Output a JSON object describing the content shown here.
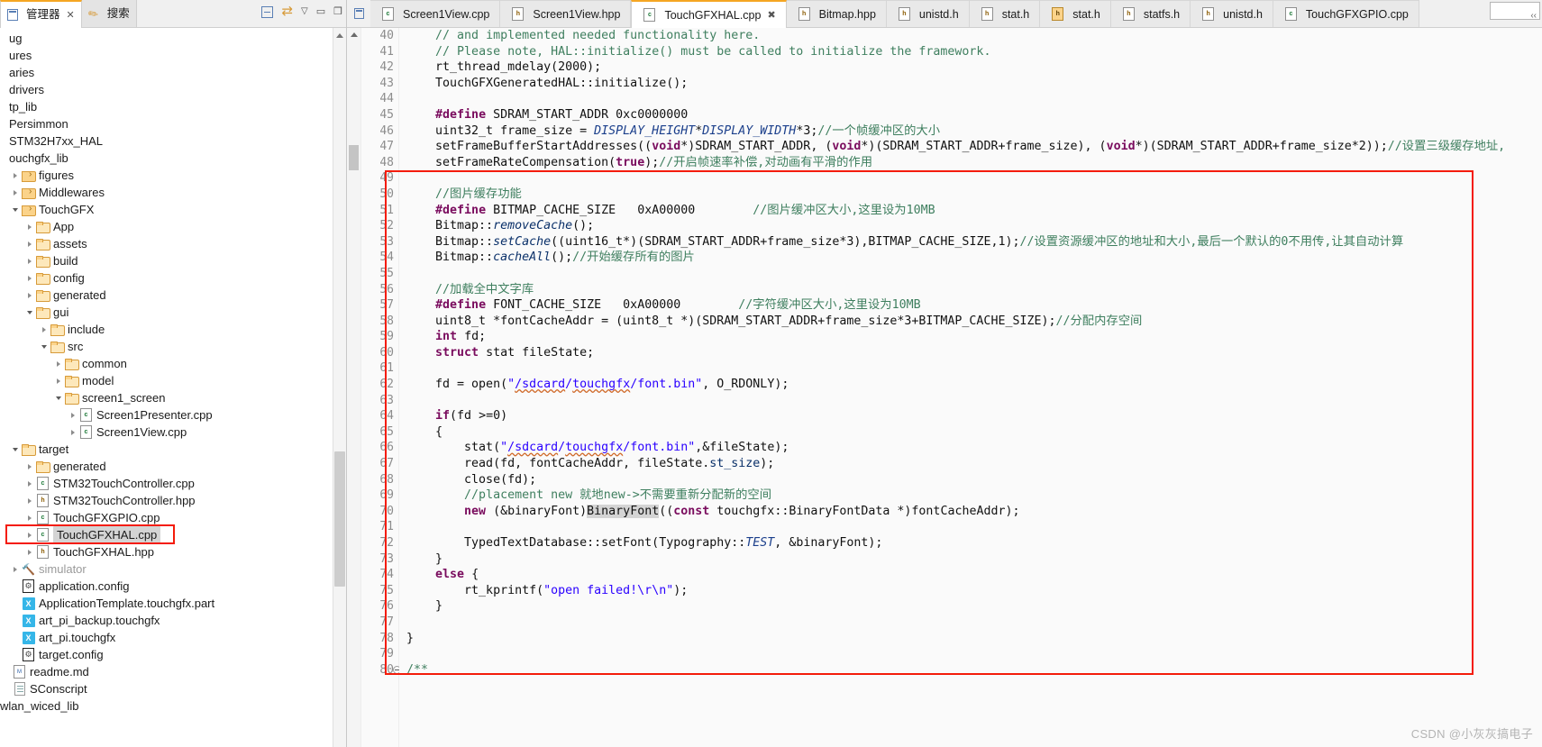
{
  "left_panel": {
    "tabs": [
      {
        "label": "管理器",
        "icon": "project-explorer-icon",
        "active": true,
        "closable": true
      },
      {
        "label": "搜索",
        "icon": "search-icon",
        "active": false,
        "closable": false
      }
    ],
    "toolbar": [
      {
        "name": "collapse-all-icon",
        "glyph": "⊟"
      },
      {
        "name": "link-with-editor-icon",
        "glyph": "⇄"
      },
      {
        "name": "view-menu-icon",
        "glyph": "▽"
      },
      {
        "name": "minimize-icon",
        "glyph": "▭"
      },
      {
        "name": "maximize-icon",
        "glyph": "▯"
      }
    ],
    "tree": [
      {
        "label": "ug",
        "indent": 0,
        "toggle": "none",
        "icon": "none",
        "clipped": true
      },
      {
        "label": "ures",
        "indent": 0,
        "toggle": "none",
        "icon": "none",
        "clipped": true
      },
      {
        "label": "aries",
        "indent": 0,
        "toggle": "none",
        "icon": "none",
        "clipped": true
      },
      {
        "label": "drivers",
        "indent": 0,
        "toggle": "none",
        "icon": "none",
        "clipped": true
      },
      {
        "label": "tp_lib",
        "indent": 0,
        "toggle": "none",
        "icon": "none",
        "clipped": true
      },
      {
        "label": "Persimmon",
        "indent": 0,
        "toggle": "none",
        "icon": "none",
        "clipped": true
      },
      {
        "label": "STM32H7xx_HAL",
        "indent": 0,
        "toggle": "none",
        "icon": "none",
        "clipped": true
      },
      {
        "label": "ouchgfx_lib",
        "indent": 0,
        "toggle": "none",
        "icon": "none",
        "clipped": true
      },
      {
        "label": "figures",
        "indent": 0,
        "toggle": "right",
        "icon": "folder-arrow"
      },
      {
        "label": "Middlewares",
        "indent": 0,
        "toggle": "right",
        "icon": "folder-arrow"
      },
      {
        "label": "TouchGFX",
        "indent": 0,
        "toggle": "down",
        "icon": "folder-arrow"
      },
      {
        "label": "App",
        "indent": 1,
        "toggle": "right",
        "icon": "folder"
      },
      {
        "label": "assets",
        "indent": 1,
        "toggle": "right",
        "icon": "folder"
      },
      {
        "label": "build",
        "indent": 1,
        "toggle": "right",
        "icon": "folder"
      },
      {
        "label": "config",
        "indent": 1,
        "toggle": "right",
        "icon": "folder"
      },
      {
        "label": "generated",
        "indent": 1,
        "toggle": "right",
        "icon": "folder"
      },
      {
        "label": "gui",
        "indent": 1,
        "toggle": "down",
        "icon": "folder"
      },
      {
        "label": "include",
        "indent": 2,
        "toggle": "right",
        "icon": "folder"
      },
      {
        "label": "src",
        "indent": 2,
        "toggle": "down",
        "icon": "folder"
      },
      {
        "label": "common",
        "indent": 3,
        "toggle": "right",
        "icon": "folder"
      },
      {
        "label": "model",
        "indent": 3,
        "toggle": "right",
        "icon": "folder"
      },
      {
        "label": "screen1_screen",
        "indent": 3,
        "toggle": "down",
        "icon": "folder"
      },
      {
        "label": "Screen1Presenter.cpp",
        "indent": 4,
        "toggle": "right",
        "icon": "c-file"
      },
      {
        "label": "Screen1View.cpp",
        "indent": 4,
        "toggle": "right",
        "icon": "c-file"
      },
      {
        "label": "target",
        "indent": 0,
        "toggle": "down",
        "icon": "folder"
      },
      {
        "label": "generated",
        "indent": 1,
        "toggle": "right",
        "icon": "folder"
      },
      {
        "label": "STM32TouchController.cpp",
        "indent": 1,
        "toggle": "right",
        "icon": "c-file"
      },
      {
        "label": "STM32TouchController.hpp",
        "indent": 1,
        "toggle": "right",
        "icon": "h-file"
      },
      {
        "label": "TouchGFXGPIO.cpp",
        "indent": 1,
        "toggle": "right",
        "icon": "c-file"
      },
      {
        "label": "TouchGFXHAL.cpp",
        "indent": 1,
        "toggle": "right",
        "icon": "c-file",
        "selected": true
      },
      {
        "label": "TouchGFXHAL.hpp",
        "indent": 1,
        "toggle": "right",
        "icon": "h-file"
      },
      {
        "label": "simulator",
        "indent": 0,
        "toggle": "right",
        "icon": "wrench",
        "dimmed": true
      },
      {
        "label": "application.config",
        "indent": 0,
        "toggle": "none",
        "icon": "config-file"
      },
      {
        "label": "ApplicationTemplate.touchgfx.part",
        "indent": 0,
        "toggle": "none",
        "icon": "x-file"
      },
      {
        "label": "art_pi_backup.touchgfx",
        "indent": 0,
        "toggle": "none",
        "icon": "x-file"
      },
      {
        "label": "art_pi.touchgfx",
        "indent": 0,
        "toggle": "none",
        "icon": "x-file"
      },
      {
        "label": "target.config",
        "indent": 0,
        "toggle": "none",
        "icon": "config-file"
      },
      {
        "label": "readme.md",
        "indent": -1,
        "toggle": "none",
        "icon": "md-file"
      },
      {
        "label": "SConscript",
        "indent": -1,
        "toggle": "none",
        "icon": "script-file"
      },
      {
        "label": "wlan_wiced_lib",
        "indent": -1,
        "toggle": "none",
        "icon": "none",
        "clipped": true
      }
    ]
  },
  "editor": {
    "tabs": [
      {
        "label": "Screen1View.cpp",
        "icon": "c-file",
        "active": false
      },
      {
        "label": "Screen1View.hpp",
        "icon": "h-file",
        "active": false
      },
      {
        "label": "TouchGFXHAL.cpp",
        "icon": "c-file",
        "active": true,
        "closable": true
      },
      {
        "label": "Bitmap.hpp",
        "icon": "h-file",
        "active": false
      },
      {
        "label": "unistd.h",
        "icon": "h-file",
        "active": false
      },
      {
        "label": "stat.h",
        "icon": "h-file",
        "active": false
      },
      {
        "label": "stat.h",
        "icon": "h-file-alt",
        "active": false
      },
      {
        "label": "statfs.h",
        "icon": "h-file",
        "active": false
      },
      {
        "label": "unistd.h",
        "icon": "h-file",
        "active": false
      },
      {
        "label": "TouchGFXGPIO.cpp",
        "icon": "c-file",
        "active": false
      }
    ],
    "first_line_number": 40,
    "lines": [
      {
        "n": 40,
        "html": "    <span class='cm'>// and implemented needed functionality here.</span>"
      },
      {
        "n": 41,
        "html": "    <span class='cm'>// Please note, HAL::initialize() must be called to initialize the framework.</span>"
      },
      {
        "n": 42,
        "html": "    rt_thread_mdelay(2000);"
      },
      {
        "n": 43,
        "html": "    TouchGFXGeneratedHAL::initialize();"
      },
      {
        "n": 44,
        "html": ""
      },
      {
        "n": 45,
        "html": "    <span class='kw'>#define</span> SDRAM_START_ADDR 0xc0000000"
      },
      {
        "n": 46,
        "html": "    uint32_t frame_size = <span class='itd'>DISPLAY_HEIGHT</span>*<span class='itd'>DISPLAY_WIDTH</span>*3;<span class='cm'>//一个帧缓冲区的大小</span>"
      },
      {
        "n": 47,
        "html": "    setFrameBufferStartAddresses((<span class='kw'>void</span>*)SDRAM_START_ADDR, (<span class='kw'>void</span>*)(SDRAM_START_ADDR+frame_size), (<span class='kw'>void</span>*)(SDRAM_START_ADDR+frame_size*2));<span class='cm'>//设置三级缓存地址,</span>"
      },
      {
        "n": 48,
        "html": "    setFrameRateCompensation(<span class='kw'>true</span>);<span class='cm'>//开启帧速率补偿,对动画有平滑的作用</span>"
      },
      {
        "n": 49,
        "html": ""
      },
      {
        "n": 50,
        "html": "    <span class='cm'>//图片缓存功能</span>"
      },
      {
        "n": 51,
        "html": "    <span class='kw'>#define</span> BITMAP_CACHE_SIZE   0xA00000        <span class='cm'>//图片缓冲区大小,这里设为10MB</span>"
      },
      {
        "n": 52,
        "html": "    Bitmap::<span class='fld' style='font-style:italic'>removeCache</span>();"
      },
      {
        "n": 53,
        "html": "    Bitmap::<span class='fld' style='font-style:italic'>setCache</span>((uint16_t*)(SDRAM_START_ADDR+frame_size*3),BITMAP_CACHE_SIZE,1);<span class='cm'>//设置资源缓冲区的地址和大小,最后一个默认的0不用传,让其自动计算</span>"
      },
      {
        "n": 54,
        "html": "    Bitmap::<span class='fld' style='font-style:italic'>cacheAll</span>();<span class='cm'>//开始缓存所有的图片</span>"
      },
      {
        "n": 55,
        "html": ""
      },
      {
        "n": 56,
        "html": "    <span class='cm'>//加载全中文字库</span>"
      },
      {
        "n": 57,
        "html": "    <span class='kw'>#define</span> FONT_CACHE_SIZE   0xA00000        <span class='cm'>//字符缓冲区大小,这里设为10MB</span>"
      },
      {
        "n": 58,
        "html": "    uint8_t *fontCacheAddr = (uint8_t *)(SDRAM_START_ADDR+frame_size*3+BITMAP_CACHE_SIZE);<span class='cm'>//分配内存空间</span>"
      },
      {
        "n": 59,
        "html": "    <span class='kw'>int</span> fd;"
      },
      {
        "n": 60,
        "html": "    <span class='kw'>struct</span> stat fileState;"
      },
      {
        "n": 61,
        "html": ""
      },
      {
        "n": 62,
        "html": "    fd = open(<span class='st'>\"<span class='sq'>/sdcard</span>/<span class='sq'>touchgfx</span>/font.bin\"</span>, O_RDONLY);"
      },
      {
        "n": 63,
        "html": ""
      },
      {
        "n": 64,
        "html": "    <span class='kw'>if</span>(fd &gt;=0)"
      },
      {
        "n": 65,
        "html": "    {"
      },
      {
        "n": 66,
        "html": "        stat(<span class='st'>\"<span class='sq'>/sdcard</span>/<span class='sq'>touchgfx</span>/font.bin\"</span>,&amp;fileState);"
      },
      {
        "n": 67,
        "html": "        read(fd, fontCacheAddr, fileState.<span class='fld'>st_size</span>);"
      },
      {
        "n": 68,
        "html": "        close(fd);"
      },
      {
        "n": 69,
        "html": "        <span class='cm'>//placement new 就地new-&gt;不需要重新分配新的空间</span>"
      },
      {
        "n": 70,
        "html": "        <span class='kw'>new</span> (&amp;binaryFont)<span class='hl'>BinaryFont</span>((<span class='kw'>const</span> touchgfx::BinaryFontData *)fontCacheAddr);"
      },
      {
        "n": 71,
        "html": ""
      },
      {
        "n": 72,
        "html": "        TypedTextDatabase::setFont(Typography::<span class='itd'>TEST</span>, &amp;binaryFont);"
      },
      {
        "n": 73,
        "html": "    }"
      },
      {
        "n": 74,
        "html": "    <span class='kw'>else</span> {"
      },
      {
        "n": 75,
        "html": "        rt_kprintf(<span class='st'>\"open failed!\\r\\n\"</span>);"
      },
      {
        "n": 76,
        "html": "    }"
      },
      {
        "n": 77,
        "html": ""
      },
      {
        "n": 78,
        "html": "}"
      },
      {
        "n": 79,
        "html": ""
      },
      {
        "n": 80,
        "html": "<span class='cm'>/**</span>"
      }
    ],
    "annotation": {
      "color": "#f41c0a",
      "label": "code-highlight-box"
    }
  },
  "watermark": {
    "text": "CSDN @小灰灰搞电子"
  }
}
